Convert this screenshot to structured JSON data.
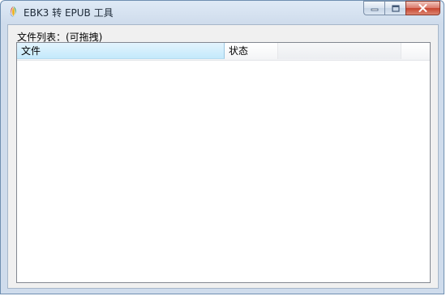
{
  "window": {
    "title": "EBK3 转 EPUB 工具",
    "app_icon": "app-logo-icon"
  },
  "caption_buttons": {
    "minimize": "minimize-icon",
    "maximize": "maximize-icon",
    "close": "close-icon"
  },
  "main": {
    "list_label": "文件列表：(可拖拽)",
    "columns": [
      {
        "label": "文件"
      },
      {
        "label": "状态"
      },
      {
        "label": ""
      }
    ],
    "rows": []
  },
  "colors": {
    "header_selected": "#c4e9fb",
    "frame_border": "#6f8fb1",
    "close_button": "#c7442f"
  }
}
